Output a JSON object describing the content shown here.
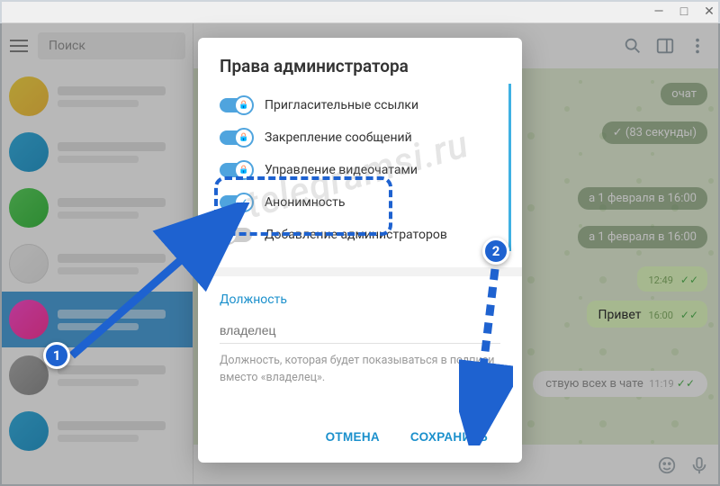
{
  "titlebar": {
    "minimize": "—",
    "maximize": "□",
    "close": "✕"
  },
  "search": {
    "placeholder": "Поиск"
  },
  "chat_header_icons": [
    "search-icon",
    "sidebar-icon",
    "more-icon"
  ],
  "service_messages": [
    "очат",
    "✓ (83 секунды)",
    "а 1 февраля в 16:00",
    "а 1 февраля в 16:00"
  ],
  "messages": [
    {
      "text": "",
      "time": "12:49",
      "ticks": "✓✓"
    },
    {
      "text": "Привет",
      "time": "16:00",
      "ticks": "✓✓"
    }
  ],
  "join_pill": {
    "text": "ствую всех в чате",
    "time": "11:19",
    "ticks": "✓✓"
  },
  "dialog": {
    "title": "Права администратора",
    "permissions": [
      {
        "label": "Пригласительные ссылки",
        "on": true,
        "icon": "lock"
      },
      {
        "label": "Закрепление сообщений",
        "on": true,
        "icon": "lock"
      },
      {
        "label": "Управление видеочатами",
        "on": true,
        "icon": "lock"
      },
      {
        "label": "Анонимность",
        "on": true,
        "icon": "check"
      },
      {
        "label": "Добавление администраторов",
        "on": false,
        "icon": "lock"
      }
    ],
    "section_label": "Должность",
    "role_placeholder": "владелец",
    "hint": "Должность, которая будет показываться в подписи вместо «владелец».",
    "cancel": "ОТМЕНА",
    "save": "СОХРАНИТЬ"
  },
  "annotations": {
    "badge1": "1",
    "badge2": "2"
  },
  "watermark": "telegramsi.ru"
}
